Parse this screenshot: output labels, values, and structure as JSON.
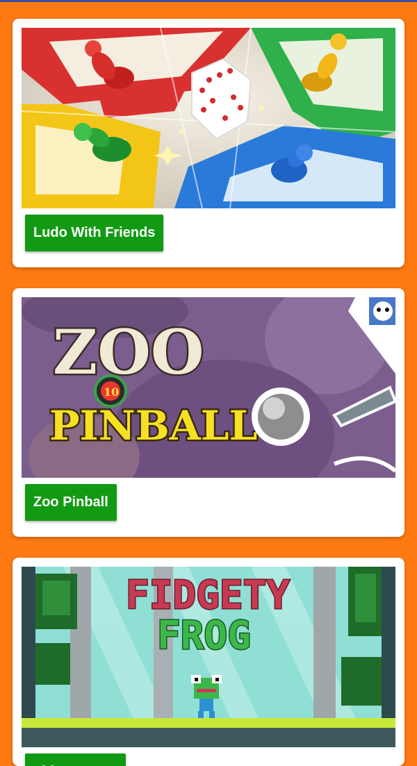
{
  "colors": {
    "background": "#ff7a12",
    "top_bar": "#3f4fa0",
    "card": "#ffffff",
    "button": "#139a14",
    "button_text": "#ffffff"
  },
  "games": [
    {
      "title": "Ludo With Friends",
      "image": "ludo-board-thumbnail"
    },
    {
      "title": "Zoo Pinball",
      "image": "zoo-pinball-thumbnail",
      "logo_lines": [
        "ZOO",
        "PINBALL"
      ],
      "logo_badge": "10"
    },
    {
      "title": "Fidgety Frog",
      "image": "fidgety-frog-thumbnail",
      "logo_lines": [
        "FIDGETY",
        "FROG"
      ]
    }
  ]
}
